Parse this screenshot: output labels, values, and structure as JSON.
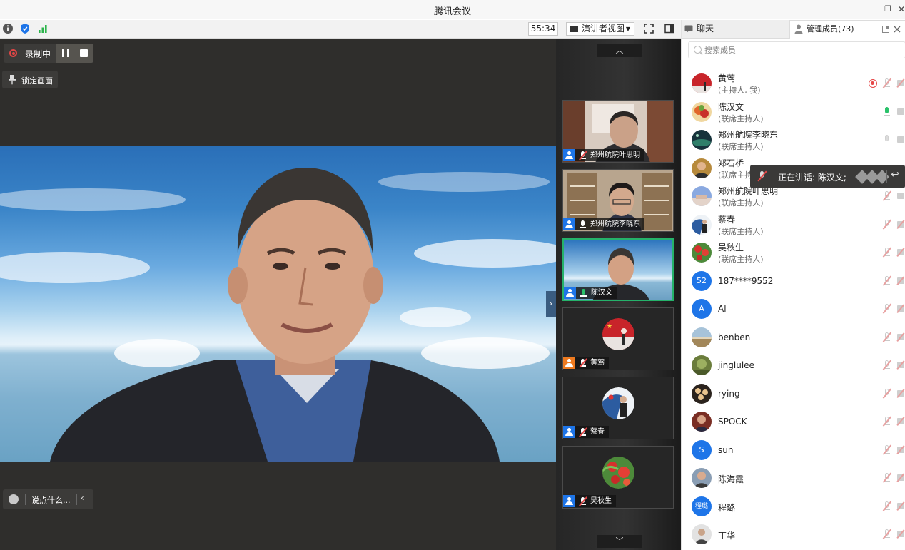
{
  "app": {
    "title": "腾讯会议"
  },
  "window": {
    "minimize": "—",
    "restore": "❐",
    "close": "✕"
  },
  "toolbar": {
    "timer": "55:34",
    "view_mode": "演讲者视图"
  },
  "recording": {
    "label": "录制中"
  },
  "lock_screen": {
    "label": "锁定画面"
  },
  "chat_input": {
    "placeholder": "说点什么..."
  },
  "gallery": {
    "tiles": [
      {
        "name": "郑州航院叶思明",
        "video": true,
        "muted": true,
        "active": false
      },
      {
        "name": "郑州航院李晓东",
        "video": true,
        "muted": false,
        "active": false
      },
      {
        "name": "陈汉文",
        "video": true,
        "muted": false,
        "speaking": true,
        "active": true
      },
      {
        "name": "黄莺",
        "video": false,
        "muted": true,
        "host": true,
        "active": false
      },
      {
        "name": "蔡春",
        "video": false,
        "muted": true,
        "active": false
      },
      {
        "name": "吴秋生",
        "video": false,
        "muted": true,
        "active": false
      }
    ]
  },
  "panel": {
    "tab_chat": "聊天",
    "tab_members": "管理成员(73)",
    "search_placeholder": "搜索成员",
    "members": [
      {
        "name": "黄莺",
        "role": "(主持人, 我)",
        "recording": true,
        "mic": "muted"
      },
      {
        "name": "陈汉文",
        "role": "(联席主持人)",
        "mic": "on"
      },
      {
        "name": "郑州航院李晓东",
        "role": "(联席主持人)",
        "mic": "idle"
      },
      {
        "name": "郑石桥",
        "role": "(联席主持人)",
        "mic": "muted"
      },
      {
        "name": "郑州航院叶思明",
        "role": "(联席主持人)",
        "mic": "muted"
      },
      {
        "name": "蔡春",
        "role": "(联席主持人)",
        "mic": "muted"
      },
      {
        "name": "吴秋生",
        "role": "(联席主持人)",
        "mic": "muted"
      },
      {
        "name": "187****9552",
        "role": "",
        "initial": "52",
        "mic": "muted"
      },
      {
        "name": "Al",
        "role": "",
        "initial": "A",
        "mic": "muted"
      },
      {
        "name": "benben",
        "role": "",
        "mic": "muted"
      },
      {
        "name": "jinglulee",
        "role": "",
        "mic": "muted"
      },
      {
        "name": "rying",
        "role": "",
        "mic": "muted"
      },
      {
        "name": "SPOCK",
        "role": "",
        "mic": "muted"
      },
      {
        "name": "sun",
        "role": "",
        "initial": "S",
        "mic": "muted"
      },
      {
        "name": "陈海霞",
        "role": "",
        "mic": "muted"
      },
      {
        "name": "程璐",
        "role": "",
        "initial": "程璐",
        "mic": "muted"
      },
      {
        "name": "丁华",
        "role": "",
        "mic": "muted"
      }
    ]
  },
  "speaking_tooltip": {
    "text": "正在讲话: 陈汉文;"
  },
  "colors": {
    "accent": "#1e75e8",
    "recording": "#e64747",
    "active_speaker": "#25b26a",
    "stage_bg": "#2f2e2c"
  }
}
